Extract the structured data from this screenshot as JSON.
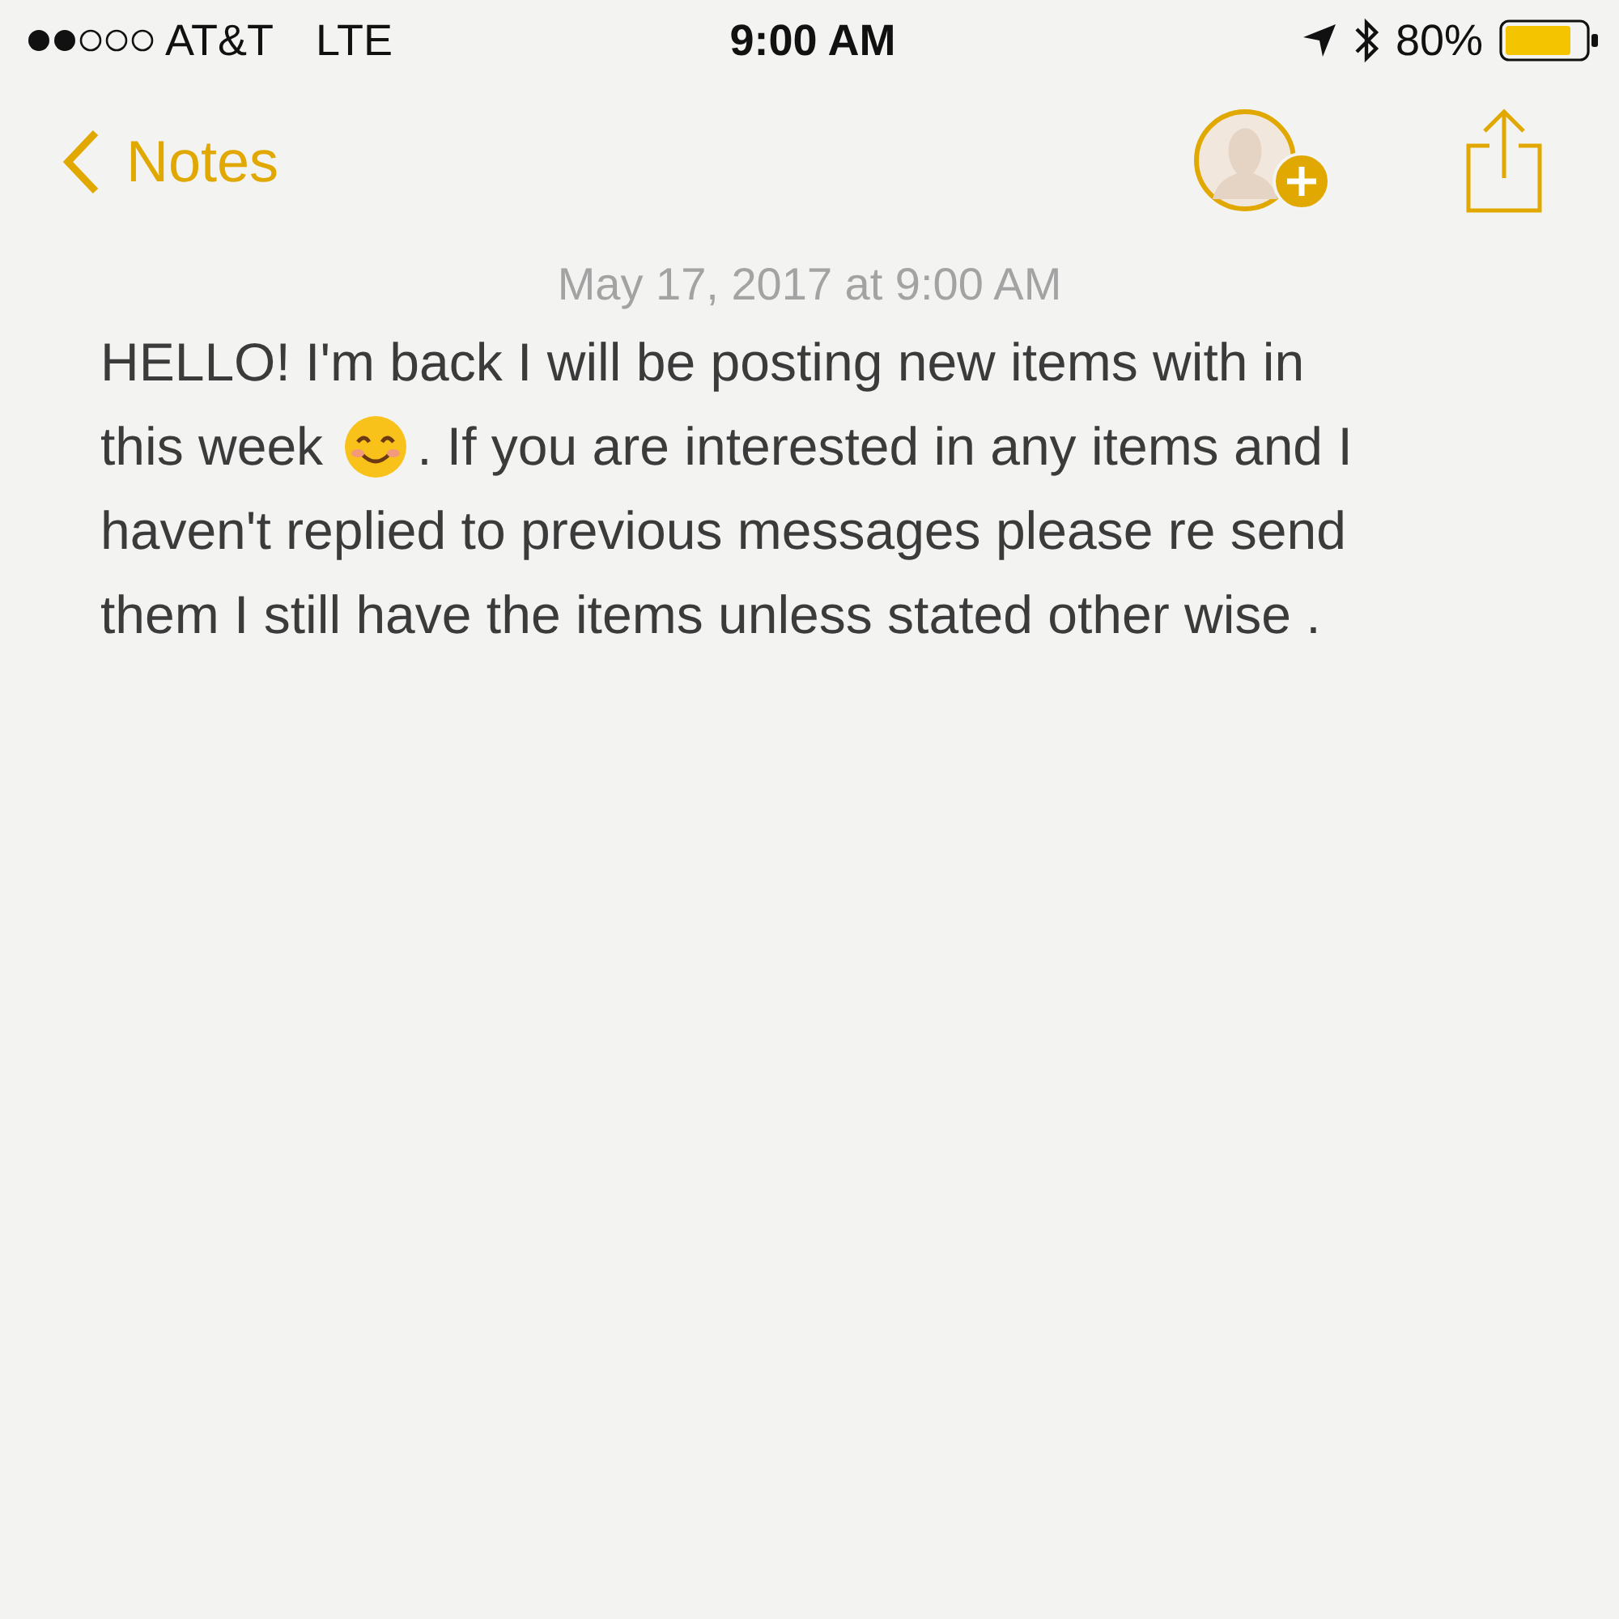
{
  "status_bar": {
    "carrier": "AT&T",
    "network": "LTE",
    "time": "9:00 AM",
    "battery_percent": "80%"
  },
  "nav_bar": {
    "back_label": "Notes"
  },
  "note": {
    "date": "May 17, 2017 at 9:00 AM",
    "lines": [
      [
        {
          "kind": "text",
          "text": "HELLO! I'm back I will be posting new items with in"
        }
      ],
      [
        {
          "kind": "text",
          "text": "this week"
        },
        {
          "kind": "emoji"
        },
        {
          "kind": "text",
          "text": ". If you are interested in any items and I"
        }
      ],
      [
        {
          "kind": "text",
          "text": "haven't replied to previous messages please re send"
        }
      ],
      [
        {
          "kind": "text",
          "text": "them I still have the items unless stated other wise ."
        }
      ]
    ]
  }
}
